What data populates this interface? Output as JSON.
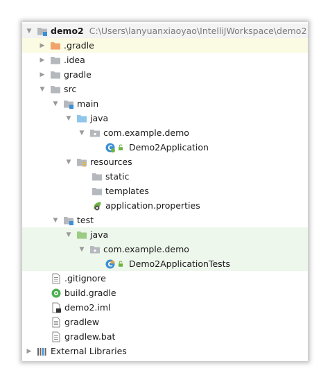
{
  "project_tree": {
    "root": {
      "name": "demo2",
      "path": "C:\\Users\\lanyuanxiaoyao\\IntelliJWorkspace\\demo2"
    },
    "items": [
      {
        "label": ".gradle"
      },
      {
        "label": ".idea"
      },
      {
        "label": "gradle"
      },
      {
        "label": "src"
      },
      {
        "label": "main"
      },
      {
        "label": "java"
      },
      {
        "label": "com.example.demo"
      },
      {
        "label": "Demo2Application"
      },
      {
        "label": "resources"
      },
      {
        "label": "static"
      },
      {
        "label": "templates"
      },
      {
        "label": "application.properties"
      },
      {
        "label": "test"
      },
      {
        "label": "java"
      },
      {
        "label": "com.example.demo"
      },
      {
        "label": "Demo2ApplicationTests"
      },
      {
        "label": ".gitignore"
      },
      {
        "label": "build.gradle"
      },
      {
        "label": "demo2.iml"
      },
      {
        "label": "gradlew"
      },
      {
        "label": "gradlew.bat"
      },
      {
        "label": "External Libraries"
      }
    ]
  },
  "colors": {
    "folder_gray": "#b5b9be",
    "folder_orange": "#f0a36b",
    "folder_blue": "#8fc6ea",
    "folder_green": "#9ccb84",
    "module_badge": "#3b8fd6",
    "highlight_yellow": "#fbfbe3",
    "highlight_green": "#eef7ec"
  }
}
